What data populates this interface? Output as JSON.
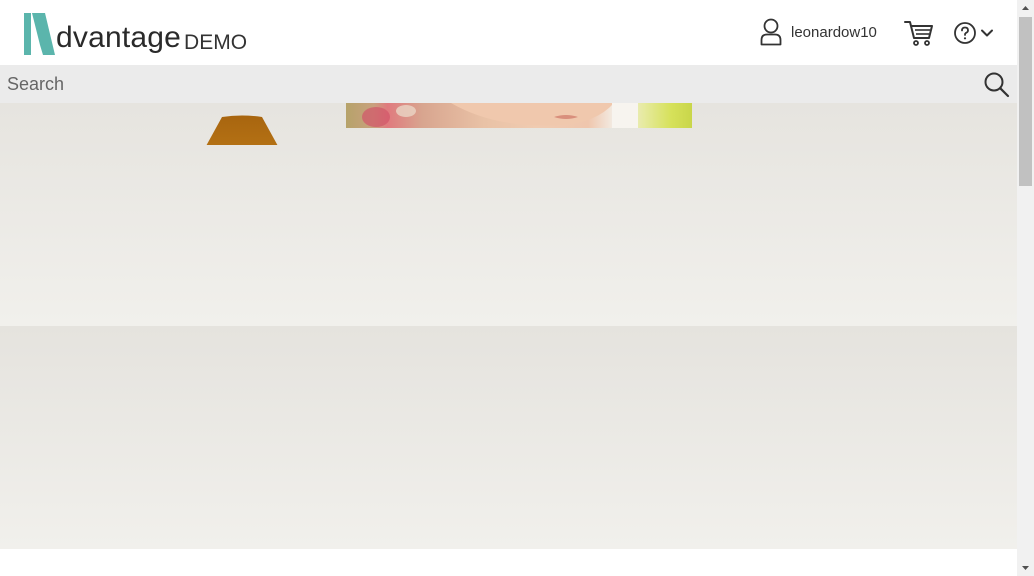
{
  "header": {
    "logo": {
      "word": "dvantage",
      "suffix": "DEMO",
      "brand_color": "#5bb5ac"
    },
    "user": {
      "icon": "user-icon",
      "name": "leonardow10"
    },
    "cart_icon": "cart-icon",
    "help_icon": "help-icon",
    "help_dropdown_icon": "chevron-down-icon"
  },
  "search": {
    "placeholder": "Search",
    "value": "",
    "icon": "search-icon"
  },
  "content": {
    "band_top_color": "#e6e4df",
    "band_bottom_color": "#f1f0ec"
  },
  "scrollbar": {
    "up_icon": "scroll-up-arrow-icon",
    "down_icon": "scroll-down-arrow-icon"
  }
}
